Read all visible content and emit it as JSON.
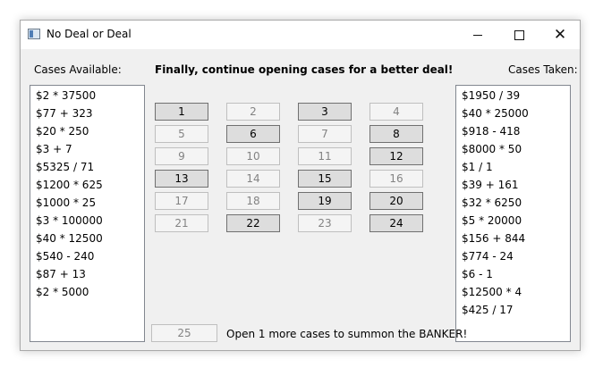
{
  "window": {
    "title": "No Deal or Deal"
  },
  "labels": {
    "cases_available": "Cases Available:",
    "instruction": "Finally, continue opening cases for a better deal!",
    "cases_taken": "Cases Taken:",
    "status": "Open 1 more cases to summon the BANKER!"
  },
  "available_list": [
    "$2 * 37500",
    "$77 + 323",
    "$20 * 250",
    "$3 + 7",
    "$5325 / 71",
    "$1200 * 625",
    "$1000 * 25",
    "$3 * 100000",
    "$40 * 12500",
    "$540 - 240",
    "$87 + 13",
    "$2 * 5000"
  ],
  "taken_list": [
    "$1950 / 39",
    "$40 * 25000",
    "$918 - 418",
    "$8000 * 50",
    "$1 / 1",
    "$39 + 161",
    "$32 * 6250",
    "$5 * 20000",
    "$156 + 844",
    "$774 - 24",
    "$6 - 1",
    "$12500 * 4",
    "$425 / 17"
  ],
  "cases": [
    {
      "label": "1",
      "enabled": true
    },
    {
      "label": "2",
      "enabled": false
    },
    {
      "label": "3",
      "enabled": true
    },
    {
      "label": "4",
      "enabled": false
    },
    {
      "label": "5",
      "enabled": false
    },
    {
      "label": "6",
      "enabled": true
    },
    {
      "label": "7",
      "enabled": false
    },
    {
      "label": "8",
      "enabled": true
    },
    {
      "label": "9",
      "enabled": false
    },
    {
      "label": "10",
      "enabled": false
    },
    {
      "label": "11",
      "enabled": false
    },
    {
      "label": "12",
      "enabled": true
    },
    {
      "label": "13",
      "enabled": true
    },
    {
      "label": "14",
      "enabled": false
    },
    {
      "label": "15",
      "enabled": true
    },
    {
      "label": "16",
      "enabled": false
    },
    {
      "label": "17",
      "enabled": false
    },
    {
      "label": "18",
      "enabled": false
    },
    {
      "label": "19",
      "enabled": true
    },
    {
      "label": "20",
      "enabled": true
    },
    {
      "label": "21",
      "enabled": false
    },
    {
      "label": "22",
      "enabled": true
    },
    {
      "label": "23",
      "enabled": false
    },
    {
      "label": "24",
      "enabled": true
    }
  ],
  "last_case": {
    "label": "25",
    "enabled": false
  }
}
